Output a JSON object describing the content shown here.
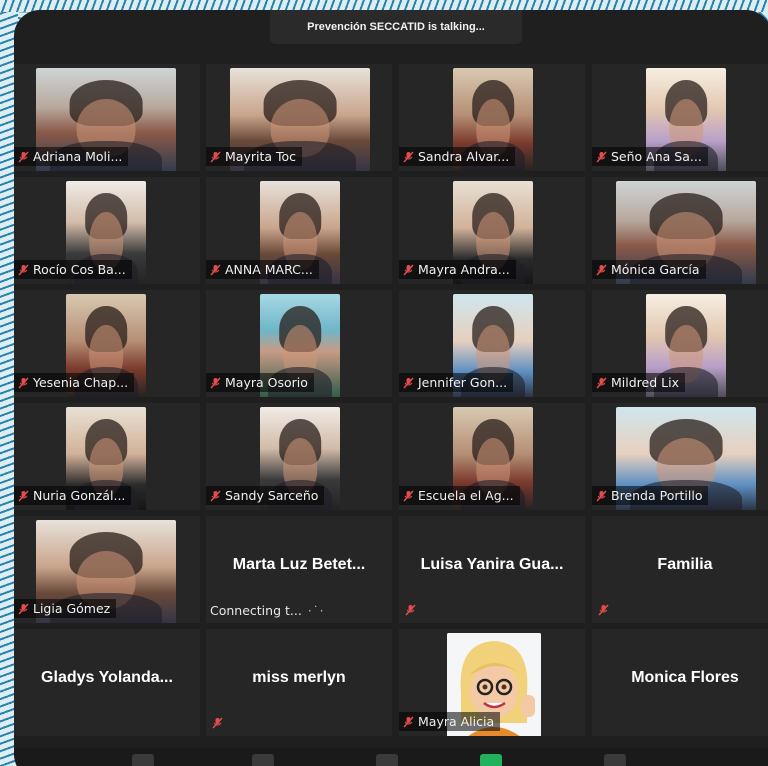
{
  "header": {
    "speaking": "Prevención SECCATID is talking..."
  },
  "participants": [
    {
      "name": "Adriana Moli...",
      "video": true
    },
    {
      "name": "Mayrita Toc",
      "video": true
    },
    {
      "name": "Sandra Alvar...",
      "video": true
    },
    {
      "name": "Seño Ana Sa...",
      "video": true
    },
    {
      "name": "Rocío Cos Ba...",
      "video": true
    },
    {
      "name": "ANNA MARC...",
      "video": true
    },
    {
      "name": "Mayra Andra...",
      "video": true
    },
    {
      "name": "Mónica García",
      "video": true
    },
    {
      "name": "Yesenia Chap...",
      "video": true
    },
    {
      "name": "Mayra Osorio",
      "video": true
    },
    {
      "name": "Jennifer Gon...",
      "video": true
    },
    {
      "name": "Mildred Lix",
      "video": true
    },
    {
      "name": "Nuria Gonzál...",
      "video": true
    },
    {
      "name": "Sandy Sarceño",
      "video": true
    },
    {
      "name": "Escuela el Ag...",
      "video": true
    },
    {
      "name": "Brenda Portillo",
      "video": true
    },
    {
      "name": "Ligia Gómez",
      "video": true
    },
    {
      "name": "Marta Luz Betet...",
      "video": false,
      "status": "Connecting t..."
    },
    {
      "name": "Luisa Yanira Gua...",
      "video": false
    },
    {
      "name": "Familia",
      "video": false
    },
    {
      "name": "Gladys Yolanda...",
      "video": false
    },
    {
      "name": "miss merlyn",
      "video": false
    },
    {
      "name": "Mayra Alicia",
      "video": true
    },
    {
      "name": "Monica Flores",
      "video": false
    }
  ],
  "colors": {
    "muted": "#e24c4c",
    "tile": "#262626",
    "window": "#1f1f1f"
  }
}
